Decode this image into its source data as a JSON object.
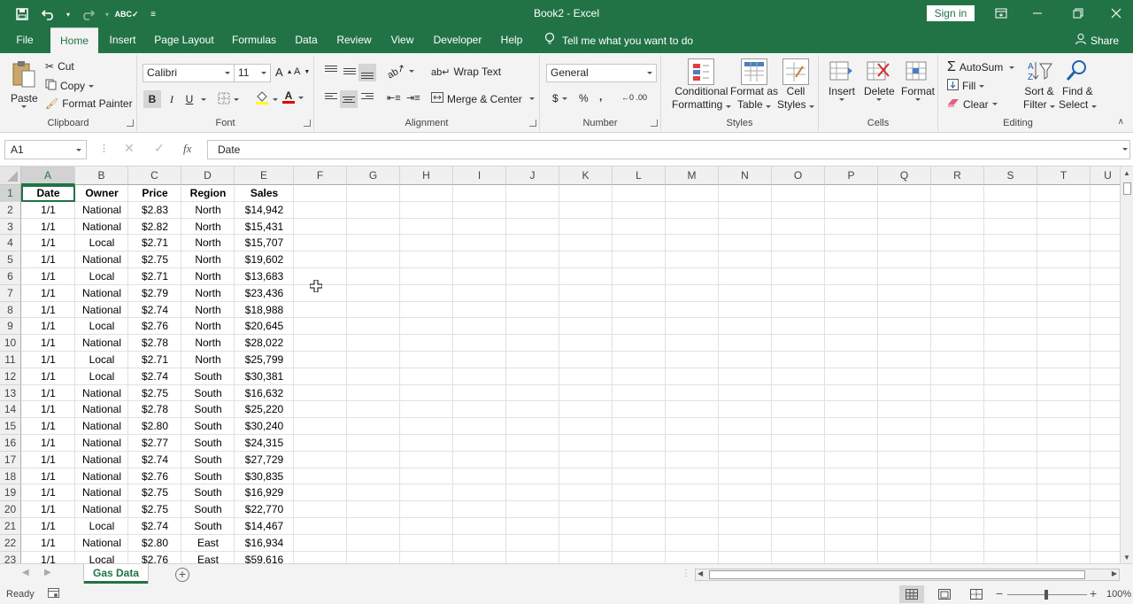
{
  "window": {
    "title": "Book2  -  Excel",
    "sign_in": "Sign in",
    "share": "Share",
    "tell_me": "Tell me what you want to do"
  },
  "tabs": [
    "File",
    "Home",
    "Insert",
    "Page Layout",
    "Formulas",
    "Data",
    "Review",
    "View",
    "Developer",
    "Help"
  ],
  "active_tab": "Home",
  "ribbon": {
    "clipboard": {
      "label": "Clipboard",
      "paste": "Paste",
      "cut": "Cut",
      "copy": "Copy",
      "format_painter": "Format Painter"
    },
    "font": {
      "label": "Font",
      "font_name": "Calibri",
      "font_size": "11",
      "bold": "B",
      "italic": "I",
      "underline": "U"
    },
    "alignment": {
      "label": "Alignment",
      "wrap_text": "Wrap Text",
      "merge_center": "Merge & Center"
    },
    "number": {
      "label": "Number",
      "format": "General",
      "currency": "$",
      "percent": "%",
      "comma": ","
    },
    "styles": {
      "label": "Styles",
      "conditional_1": "Conditional",
      "conditional_2": "Formatting",
      "format_table_1": "Format as",
      "format_table_2": "Table",
      "cell_styles_1": "Cell",
      "cell_styles_2": "Styles"
    },
    "cells": {
      "label": "Cells",
      "insert": "Insert",
      "delete": "Delete",
      "format": "Format"
    },
    "editing": {
      "label": "Editing",
      "autosum": "AutoSum",
      "fill": "Fill",
      "clear": "Clear",
      "sort_1": "Sort &",
      "sort_2": "Filter",
      "find_1": "Find &",
      "find_2": "Select"
    }
  },
  "formula_bar": {
    "name_box": "A1",
    "fx": "fx",
    "value": "Date"
  },
  "columns": [
    "A",
    "B",
    "C",
    "D",
    "E",
    "F",
    "G",
    "H",
    "I",
    "J",
    "K",
    "L",
    "M",
    "N",
    "O",
    "P",
    "Q",
    "R",
    "S",
    "T",
    "U"
  ],
  "table_headers": [
    "Date",
    "Owner",
    "Price",
    "Region",
    "Sales"
  ],
  "rows": [
    [
      "1/1",
      "National",
      "$2.83",
      "North",
      "$14,942"
    ],
    [
      "1/1",
      "National",
      "$2.82",
      "North",
      "$15,431"
    ],
    [
      "1/1",
      "Local",
      "$2.71",
      "North",
      "$15,707"
    ],
    [
      "1/1",
      "National",
      "$2.75",
      "North",
      "$19,602"
    ],
    [
      "1/1",
      "Local",
      "$2.71",
      "North",
      "$13,683"
    ],
    [
      "1/1",
      "National",
      "$2.79",
      "North",
      "$23,436"
    ],
    [
      "1/1",
      "National",
      "$2.74",
      "North",
      "$18,988"
    ],
    [
      "1/1",
      "Local",
      "$2.76",
      "North",
      "$20,645"
    ],
    [
      "1/1",
      "National",
      "$2.78",
      "North",
      "$28,022"
    ],
    [
      "1/1",
      "Local",
      "$2.71",
      "North",
      "$25,799"
    ],
    [
      "1/1",
      "Local",
      "$2.74",
      "South",
      "$30,381"
    ],
    [
      "1/1",
      "National",
      "$2.75",
      "South",
      "$16,632"
    ],
    [
      "1/1",
      "National",
      "$2.78",
      "South",
      "$25,220"
    ],
    [
      "1/1",
      "National",
      "$2.80",
      "South",
      "$30,240"
    ],
    [
      "1/1",
      "National",
      "$2.77",
      "South",
      "$24,315"
    ],
    [
      "1/1",
      "National",
      "$2.74",
      "South",
      "$27,729"
    ],
    [
      "1/1",
      "National",
      "$2.76",
      "South",
      "$30,835"
    ],
    [
      "1/1",
      "National",
      "$2.75",
      "South",
      "$16,929"
    ],
    [
      "1/1",
      "National",
      "$2.75",
      "South",
      "$22,770"
    ],
    [
      "1/1",
      "Local",
      "$2.74",
      "South",
      "$14,467"
    ],
    [
      "1/1",
      "National",
      "$2.80",
      "East",
      "$16,934"
    ],
    [
      "1/1",
      "Local",
      "$2.76",
      "East",
      "$59,616"
    ]
  ],
  "sheet_tab": "Gas Data",
  "status": {
    "ready": "Ready",
    "zoom": "100%"
  },
  "colors": {
    "accent": "#217346"
  }
}
